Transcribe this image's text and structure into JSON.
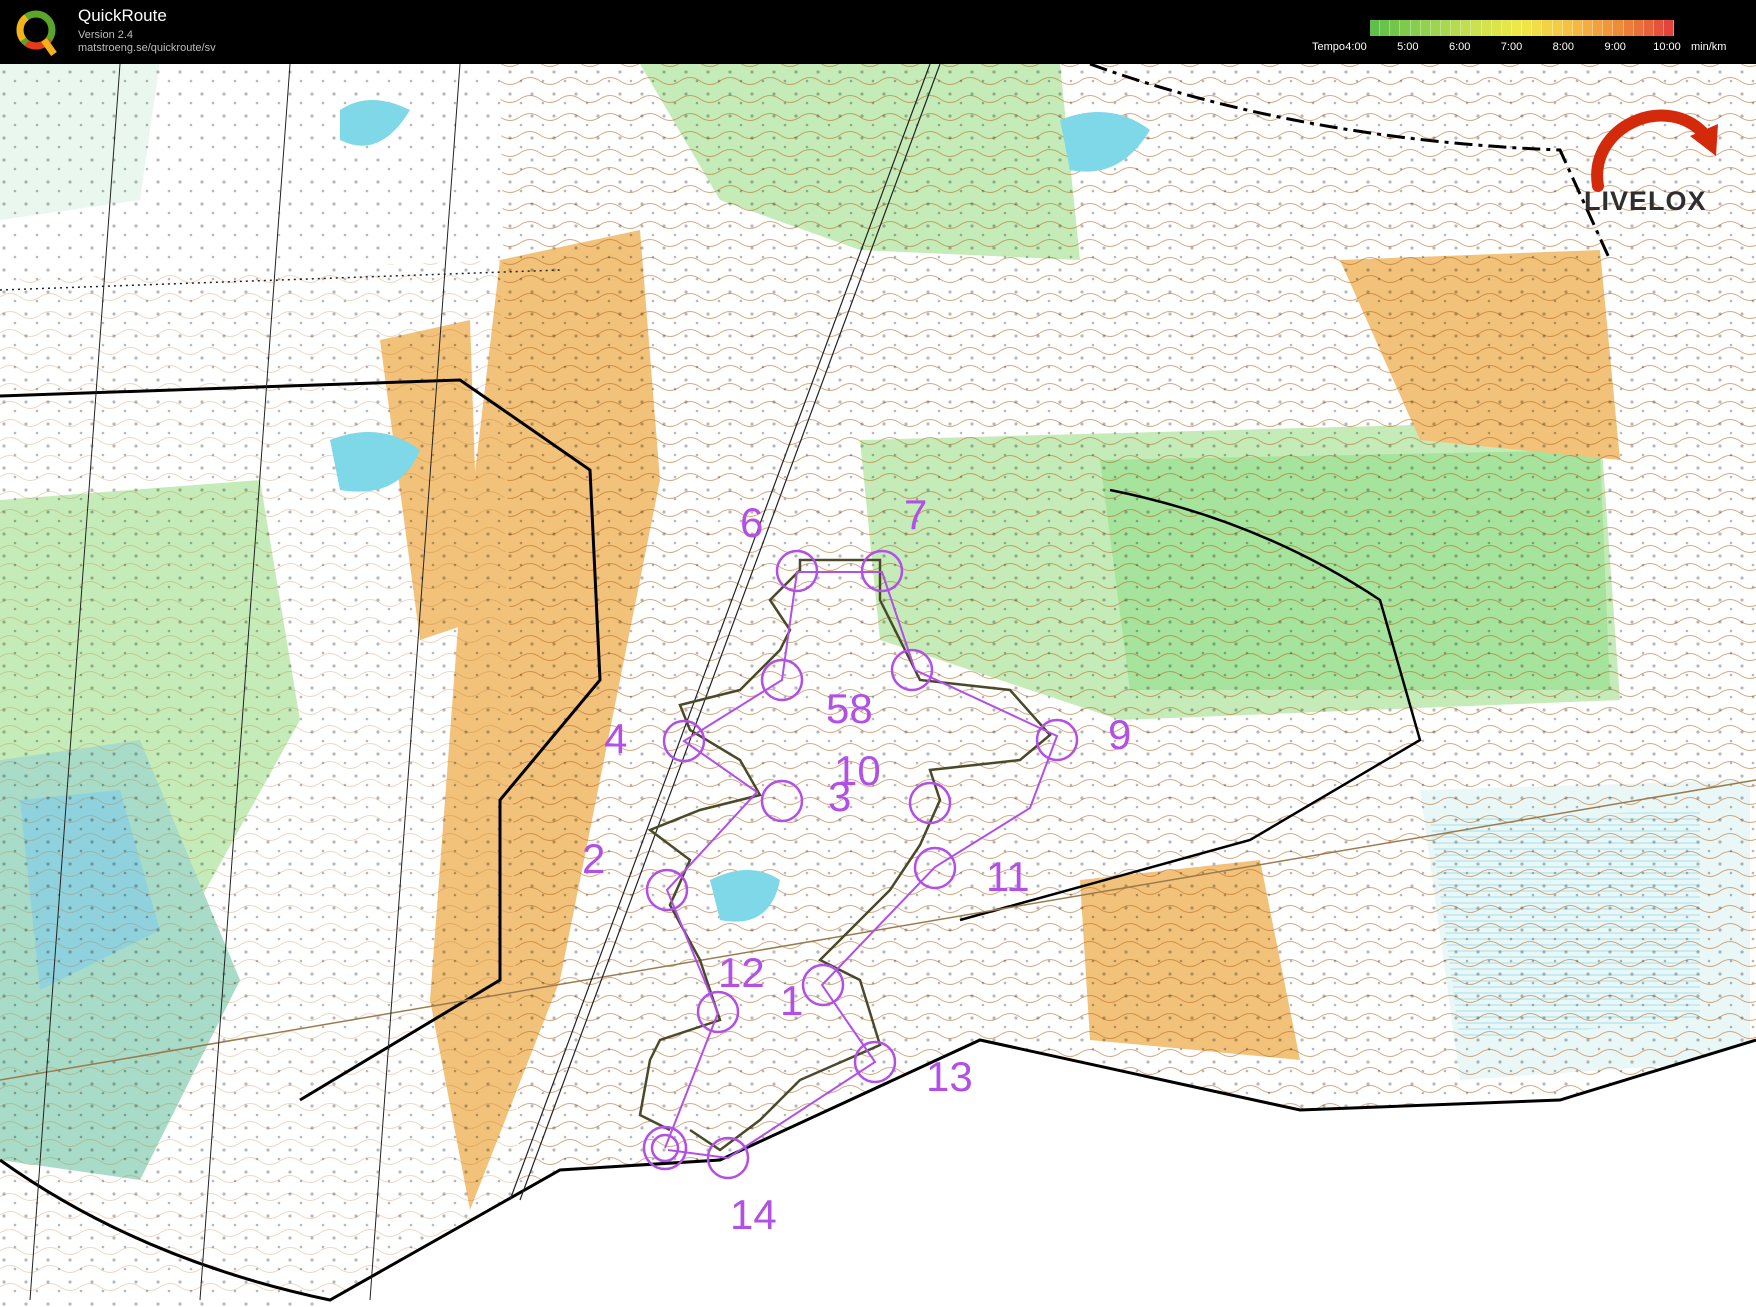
{
  "app": {
    "title": "QuickRoute",
    "version": "Version 2.4",
    "url": "matstroeng.se/quickroute/sv"
  },
  "tempo_legend": {
    "label": "Tempo",
    "ticks": [
      "4:00",
      "5:00",
      "6:00",
      "7:00",
      "8:00",
      "9:00",
      "10:00"
    ],
    "unit": "min/km",
    "gradient_colors": [
      "#5fbf4a",
      "#8fd14f",
      "#c9e04f",
      "#f0e84a",
      "#f5c043",
      "#ee8a3a",
      "#e4453a"
    ]
  },
  "brand": {
    "name": "LIVELOX",
    "colors": {
      "arrow": "#d42a0c",
      "text": "#2e2e2e"
    }
  },
  "course": {
    "color": "#b24fe6",
    "control_labels": [
      "1",
      "2",
      "3",
      "4",
      "58",
      "6",
      "7",
      "9",
      "10",
      "11",
      "12",
      "13",
      "14"
    ]
  },
  "map_colors": {
    "open_land": "#f2c27a",
    "forest_green": "#8ee08a",
    "light_green": "#c5ecb8",
    "water": "#7ed8e8",
    "contour": "#b5651d",
    "route": "#4a4a2a"
  }
}
